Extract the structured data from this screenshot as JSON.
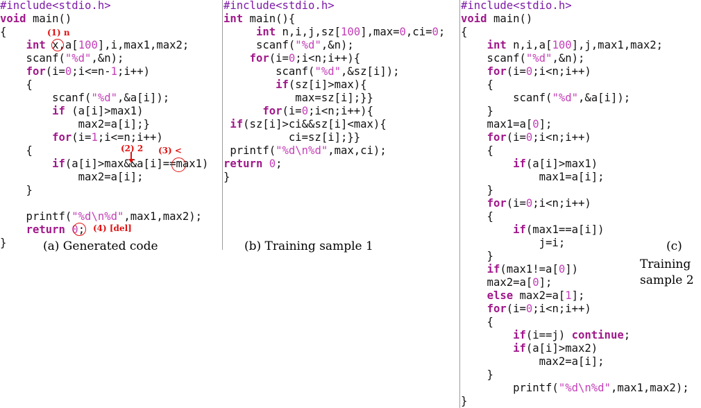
{
  "panels": [
    {
      "caption": "(a) Generated code",
      "lines": [
        [
          [
            "pp",
            "#include<stdio.h>"
          ]
        ],
        [
          [
            "kw",
            "void"
          ],
          [
            "t",
            " main()"
          ]
        ],
        [
          [
            "t",
            "{"
          ]
        ],
        [
          [
            "t",
            "    "
          ],
          [
            "kw",
            "int"
          ],
          [
            "t",
            " x,a["
          ],
          [
            "num",
            "100"
          ],
          [
            "t",
            "],i,max1,max2;"
          ]
        ],
        [
          [
            "t",
            "    scanf("
          ],
          [
            "str",
            "\"%d\""
          ],
          [
            "t",
            ",&n);"
          ]
        ],
        [
          [
            "t",
            "    "
          ],
          [
            "kw",
            "for"
          ],
          [
            "t",
            "(i="
          ],
          [
            "num",
            "0"
          ],
          [
            "t",
            ";i<=n-"
          ],
          [
            "num",
            "1"
          ],
          [
            "t",
            ";i++)"
          ]
        ],
        [
          [
            "t",
            "    {"
          ]
        ],
        [
          [
            "t",
            "        scanf("
          ],
          [
            "str",
            "\"%d\""
          ],
          [
            "t",
            ",&a[i]);"
          ]
        ],
        [
          [
            "t",
            "        "
          ],
          [
            "kw",
            "if"
          ],
          [
            "t",
            " (a[i]>max1)"
          ]
        ],
        [
          [
            "t",
            "            max2=a[i];}"
          ]
        ],
        [
          [
            "t",
            "        "
          ],
          [
            "kw",
            "for"
          ],
          [
            "t",
            "(i="
          ],
          [
            "num",
            "1"
          ],
          [
            "t",
            ";i<=n;i++)"
          ]
        ],
        [
          [
            "t",
            "    {"
          ]
        ],
        [
          [
            "t",
            "        "
          ],
          [
            "kw",
            "if"
          ],
          [
            "t",
            "(a[i]>max&&a[i]==max1)"
          ]
        ],
        [
          [
            "t",
            "            max2=a[i];"
          ]
        ],
        [
          [
            "t",
            "    }"
          ]
        ],
        [
          [
            "t",
            ""
          ]
        ],
        [
          [
            "t",
            "    printf("
          ],
          [
            "str",
            "\"%d\\n%d\""
          ],
          [
            "t",
            ",max1,max2);"
          ]
        ],
        [
          [
            "t",
            "    "
          ],
          [
            "kw",
            "return"
          ],
          [
            "t",
            " "
          ],
          [
            "num",
            "0"
          ],
          [
            "t",
            ";"
          ]
        ],
        [
          [
            "t",
            "}"
          ]
        ]
      ],
      "annotations": {
        "a1": "(1) n",
        "a2": "(2) 2",
        "a3": "(3) <",
        "a4": "(4) [del]"
      }
    },
    {
      "caption": "(b) Training sample 1",
      "lines": [
        [
          [
            "pp",
            "#include<stdio.h>"
          ]
        ],
        [
          [
            "kw",
            "int"
          ],
          [
            "t",
            " main(){"
          ]
        ],
        [
          [
            "t",
            "     "
          ],
          [
            "kw",
            "int"
          ],
          [
            "t",
            " n,i,j,sz["
          ],
          [
            "num",
            "100"
          ],
          [
            "t",
            "],max="
          ],
          [
            "num",
            "0"
          ],
          [
            "t",
            ",ci="
          ],
          [
            "num",
            "0"
          ],
          [
            "t",
            ";"
          ]
        ],
        [
          [
            "t",
            "     scanf("
          ],
          [
            "str",
            "\"%d\""
          ],
          [
            "t",
            ",&n);"
          ]
        ],
        [
          [
            "t",
            "    "
          ],
          [
            "kw",
            "for"
          ],
          [
            "t",
            "(i="
          ],
          [
            "num",
            "0"
          ],
          [
            "t",
            ";i<n;i++){"
          ]
        ],
        [
          [
            "t",
            "        scanf("
          ],
          [
            "str",
            "\"%d\""
          ],
          [
            "t",
            ",&sz[i]);"
          ]
        ],
        [
          [
            "t",
            "        "
          ],
          [
            "kw",
            "if"
          ],
          [
            "t",
            "(sz[i]>max){"
          ]
        ],
        [
          [
            "t",
            "           max=sz[i];}}"
          ]
        ],
        [
          [
            "t",
            "      "
          ],
          [
            "kw",
            "for"
          ],
          [
            "t",
            "(i="
          ],
          [
            "num",
            "0"
          ],
          [
            "t",
            ";i<n;i++){"
          ]
        ],
        [
          [
            "t",
            " "
          ],
          [
            "kw",
            "if"
          ],
          [
            "t",
            "(sz[i]>ci&&sz[i]<max){"
          ]
        ],
        [
          [
            "t",
            "          ci=sz[i];}}"
          ]
        ],
        [
          [
            "t",
            " printf("
          ],
          [
            "str",
            "\"%d\\n%d\""
          ],
          [
            "t",
            ",max,ci);"
          ]
        ],
        [
          [
            "kw",
            "return"
          ],
          [
            "t",
            " "
          ],
          [
            "num",
            "0"
          ],
          [
            "t",
            ";"
          ]
        ],
        [
          [
            "t",
            "}"
          ]
        ]
      ]
    },
    {
      "caption_line1": "(c)",
      "caption_line2": "Training",
      "caption_line3": "sample 2",
      "lines": [
        [
          [
            "pp",
            "#include<stdio.h>"
          ]
        ],
        [
          [
            "kw",
            "void"
          ],
          [
            "t",
            " main()"
          ]
        ],
        [
          [
            "t",
            "{"
          ]
        ],
        [
          [
            "t",
            "    "
          ],
          [
            "kw",
            "int"
          ],
          [
            "t",
            " n,i,a["
          ],
          [
            "num",
            "100"
          ],
          [
            "t",
            "],j,max1,max2;"
          ]
        ],
        [
          [
            "t",
            "    scanf("
          ],
          [
            "str",
            "\"%d\""
          ],
          [
            "t",
            ",&n);"
          ]
        ],
        [
          [
            "t",
            "    "
          ],
          [
            "kw",
            "for"
          ],
          [
            "t",
            "(i="
          ],
          [
            "num",
            "0"
          ],
          [
            "t",
            ";i<n;i++)"
          ]
        ],
        [
          [
            "t",
            "    {"
          ]
        ],
        [
          [
            "t",
            "        scanf("
          ],
          [
            "str",
            "\"%d\""
          ],
          [
            "t",
            ",&a[i]);"
          ]
        ],
        [
          [
            "t",
            "    }"
          ]
        ],
        [
          [
            "t",
            "    max1=a["
          ],
          [
            "num",
            "0"
          ],
          [
            "t",
            "];"
          ]
        ],
        [
          [
            "t",
            "    "
          ],
          [
            "kw",
            "for"
          ],
          [
            "t",
            "(i="
          ],
          [
            "num",
            "0"
          ],
          [
            "t",
            ";i<n;i++)"
          ]
        ],
        [
          [
            "t",
            "    {"
          ]
        ],
        [
          [
            "t",
            "        "
          ],
          [
            "kw",
            "if"
          ],
          [
            "t",
            "(a[i]>max1)"
          ]
        ],
        [
          [
            "t",
            "            max1=a[i];"
          ]
        ],
        [
          [
            "t",
            "    }"
          ]
        ],
        [
          [
            "t",
            "    "
          ],
          [
            "kw",
            "for"
          ],
          [
            "t",
            "(i="
          ],
          [
            "num",
            "0"
          ],
          [
            "t",
            ";i<n;i++)"
          ]
        ],
        [
          [
            "t",
            "    {"
          ]
        ],
        [
          [
            "t",
            "        "
          ],
          [
            "kw",
            "if"
          ],
          [
            "t",
            "(max1==a[i])"
          ]
        ],
        [
          [
            "t",
            "            j=i;"
          ]
        ],
        [
          [
            "t",
            "    }"
          ]
        ],
        [
          [
            "t",
            "    "
          ],
          [
            "kw",
            "if"
          ],
          [
            "t",
            "(max1!=a["
          ],
          [
            "num",
            "0"
          ],
          [
            "t",
            "])"
          ]
        ],
        [
          [
            "t",
            "    max2=a["
          ],
          [
            "num",
            "0"
          ],
          [
            "t",
            "];"
          ]
        ],
        [
          [
            "t",
            "    "
          ],
          [
            "kw",
            "else"
          ],
          [
            "t",
            " max2=a["
          ],
          [
            "num",
            "1"
          ],
          [
            "t",
            "];"
          ]
        ],
        [
          [
            "t",
            "    "
          ],
          [
            "kw",
            "for"
          ],
          [
            "t",
            "(i="
          ],
          [
            "num",
            "0"
          ],
          [
            "t",
            ";i<n;i++)"
          ]
        ],
        [
          [
            "t",
            "    {"
          ]
        ],
        [
          [
            "t",
            "        "
          ],
          [
            "kw",
            "if"
          ],
          [
            "t",
            "(i==j) "
          ],
          [
            "kw",
            "continue"
          ],
          [
            "t",
            ";"
          ]
        ],
        [
          [
            "t",
            "        "
          ],
          [
            "kw",
            "if"
          ],
          [
            "t",
            "(a[i]>max2)"
          ]
        ],
        [
          [
            "t",
            "            max2=a[i];"
          ]
        ],
        [
          [
            "t",
            "    }"
          ]
        ],
        [
          [
            "t",
            "        printf("
          ],
          [
            "str",
            "\"%d\\n%d\""
          ],
          [
            "t",
            ",max1,max2);"
          ]
        ],
        [
          [
            "t",
            "}"
          ]
        ]
      ]
    }
  ]
}
